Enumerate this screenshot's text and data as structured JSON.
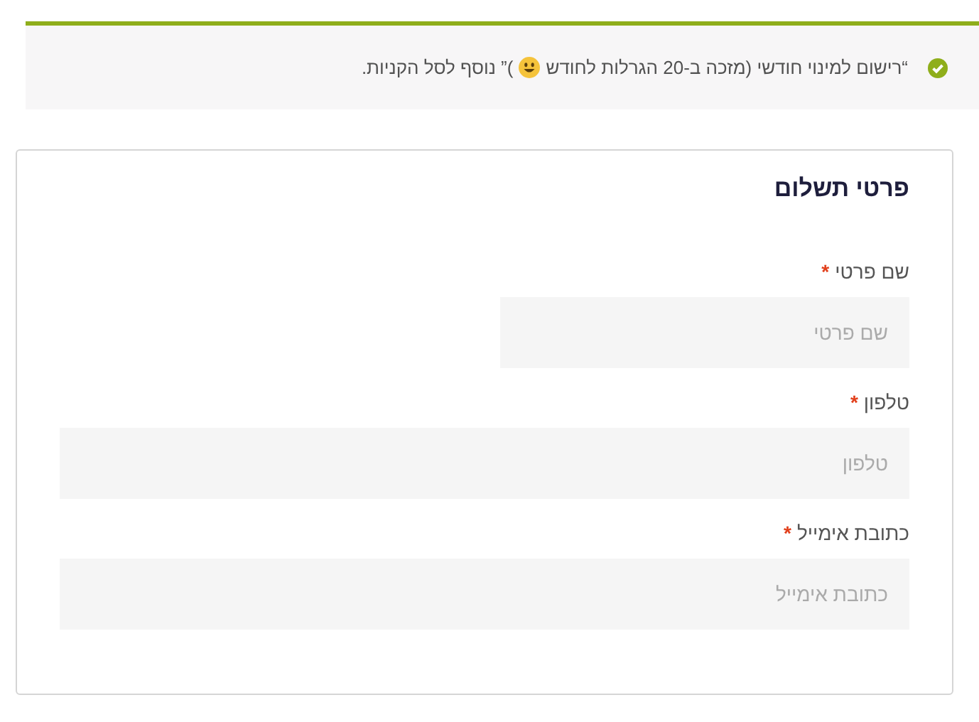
{
  "notice": {
    "success": true,
    "text_before": "“רישום למינוי חודשי (מזכה ב-20 הגרלות לחודש",
    "text_after": ")” נוסף לסל הקניות."
  },
  "form": {
    "title": "פרטי תשלום",
    "fields": [
      {
        "label": "שם פרטי",
        "required_mark": "*",
        "placeholder": "שם פרטי",
        "kind": "short"
      },
      {
        "label": "טלפון",
        "required_mark": "*",
        "placeholder": "טלפון",
        "kind": "wide"
      },
      {
        "label": "כתובת אימייל",
        "required_mark": "*",
        "placeholder": "כתובת אימייל",
        "kind": "wide"
      }
    ]
  }
}
